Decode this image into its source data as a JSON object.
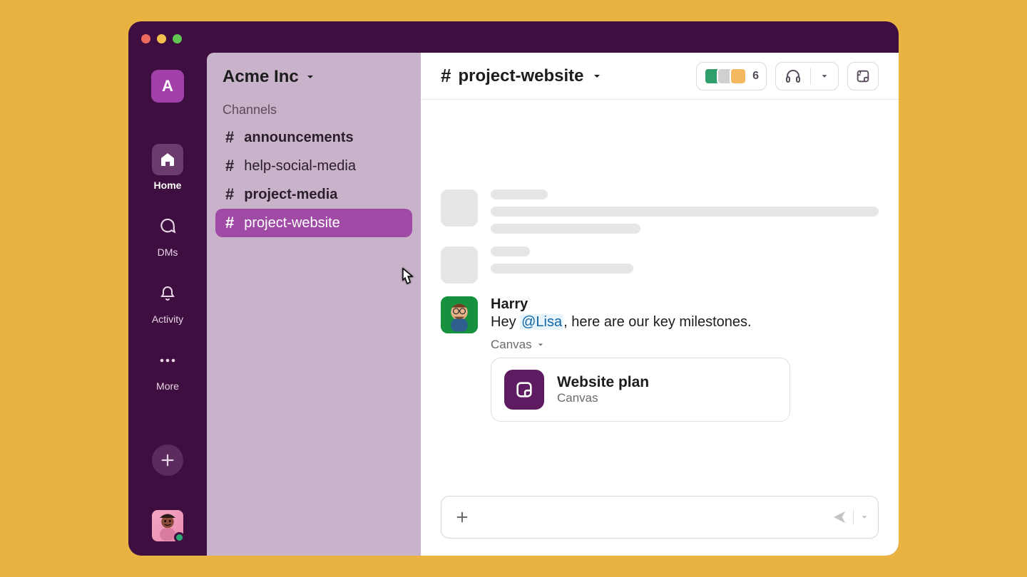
{
  "workspace": {
    "letter": "A",
    "name": "Acme Inc"
  },
  "rail": {
    "home": "Home",
    "dms": "DMs",
    "activity": "Activity",
    "more": "More"
  },
  "sidebar": {
    "section": "Channels",
    "channels": [
      {
        "name": "announcements",
        "unread": true,
        "selected": false
      },
      {
        "name": "help-social-media",
        "unread": false,
        "selected": false
      },
      {
        "name": "project-media",
        "unread": true,
        "selected": false
      },
      {
        "name": "project-website",
        "unread": false,
        "selected": true
      }
    ]
  },
  "channel_header": {
    "name": "project-website",
    "member_count": "6"
  },
  "message": {
    "author": "Harry",
    "text_pre": "Hey ",
    "mention": "@Lisa",
    "text_post": ", here are our key milestones.",
    "attach_label": "Canvas",
    "canvas_title": "Website plan",
    "canvas_sub": "Canvas"
  }
}
